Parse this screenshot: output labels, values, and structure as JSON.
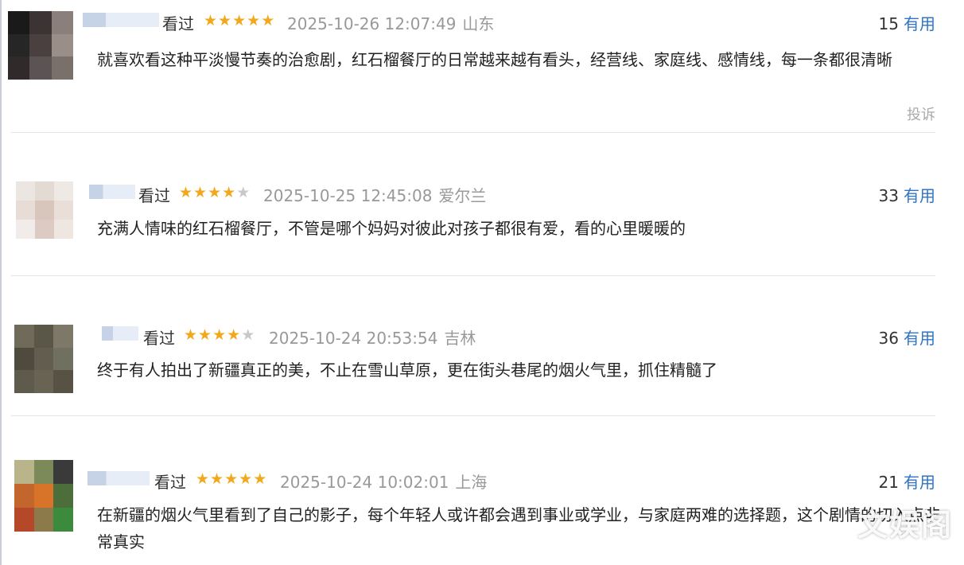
{
  "reviews": [
    {
      "status": "看过",
      "rating": 5,
      "datetime": "2025-10-26 12:07:49",
      "location": "山东",
      "useful_count": "15",
      "useful_label": "有用",
      "content": "就喜欢看这种平淡慢节奏的治愈剧，红石榴餐厅的日常越来越有看头，经营线、家庭线、感情线，每一条都很清晰",
      "report_label": "投诉",
      "avatar_colors": [
        "#1a1a1a",
        "#3c3434",
        "#8a7f7a",
        "#262626",
        "#4a4040",
        "#9a8f88",
        "#302a2a",
        "#5c5454",
        "#7a706a"
      ]
    },
    {
      "status": "看过",
      "rating": 4,
      "datetime": "2025-10-25 12:45:08",
      "location": "爱尔兰",
      "useful_count": "33",
      "useful_label": "有用",
      "content": "充满人情味的红石榴餐厅，不管是哪个妈妈对彼此对孩子都很有爱，看的心里暖暖的",
      "avatar_colors": [
        "#ece6e2",
        "#e4dad4",
        "#efe9e6",
        "#e8dcd6",
        "#d8c6bc",
        "#eadfd8",
        "#f1ece9",
        "#dccbc2",
        "#ede6e1"
      ]
    },
    {
      "status": "看过",
      "rating": 4,
      "datetime": "2025-10-24 20:53:54",
      "location": "吉林",
      "useful_count": "36",
      "useful_label": "有用",
      "content": "终于有人拍出了新疆真正的美，不止在雪山草原，更在街头巷尾的烟火气里，抓住精髓了",
      "avatar_colors": [
        "#6f6a5a",
        "#5a5648",
        "#7d7868",
        "#4e4a3e",
        "#625d4f",
        "#707060",
        "#5e5a4c",
        "#686352",
        "#575244"
      ]
    },
    {
      "status": "看过",
      "rating": 5,
      "datetime": "2025-10-24 10:02:01",
      "location": "上海",
      "useful_count": "21",
      "useful_label": "有用",
      "content": "在新疆的烟火气里看到了自己的影子，每个年轻人或许都会遇到事业或学业，与家庭两难的选择题，这个剧情的切入点非常真实",
      "avatar_colors": [
        "#b9b48a",
        "#7c8a5a",
        "#3a3a3a",
        "#c2662e",
        "#d8742a",
        "#4b6e3a",
        "#b6482a",
        "#8c7a4a",
        "#3c8a3c"
      ]
    }
  ],
  "watermark": "文娱阁"
}
